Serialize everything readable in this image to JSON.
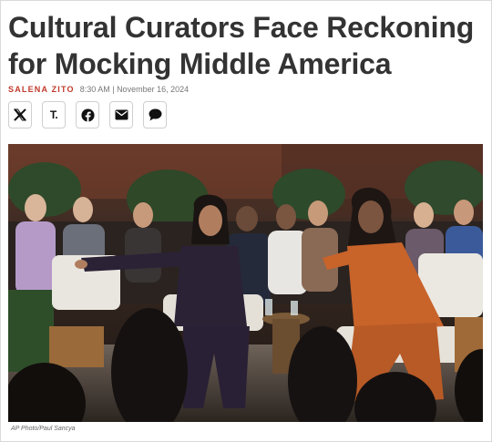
{
  "article": {
    "headline": "Cultural Curators Face Reckoning for Mocking Middle America",
    "author": "SALENA ZITO",
    "date": "8:30 AM | November 16, 2024"
  },
  "share": [
    {
      "name": "x-share",
      "icon": "x-icon"
    },
    {
      "name": "truth-social-share",
      "icon": "truth-social-icon",
      "glyph": "T."
    },
    {
      "name": "facebook-share",
      "icon": "facebook-icon"
    },
    {
      "name": "email-share",
      "icon": "envelope-icon"
    },
    {
      "name": "comment-share",
      "icon": "comment-icon"
    }
  ],
  "photo": {
    "credit": "AP Photo/Paul Sancya"
  },
  "colors": {
    "author": "#c0392b",
    "headline": "#333333"
  }
}
